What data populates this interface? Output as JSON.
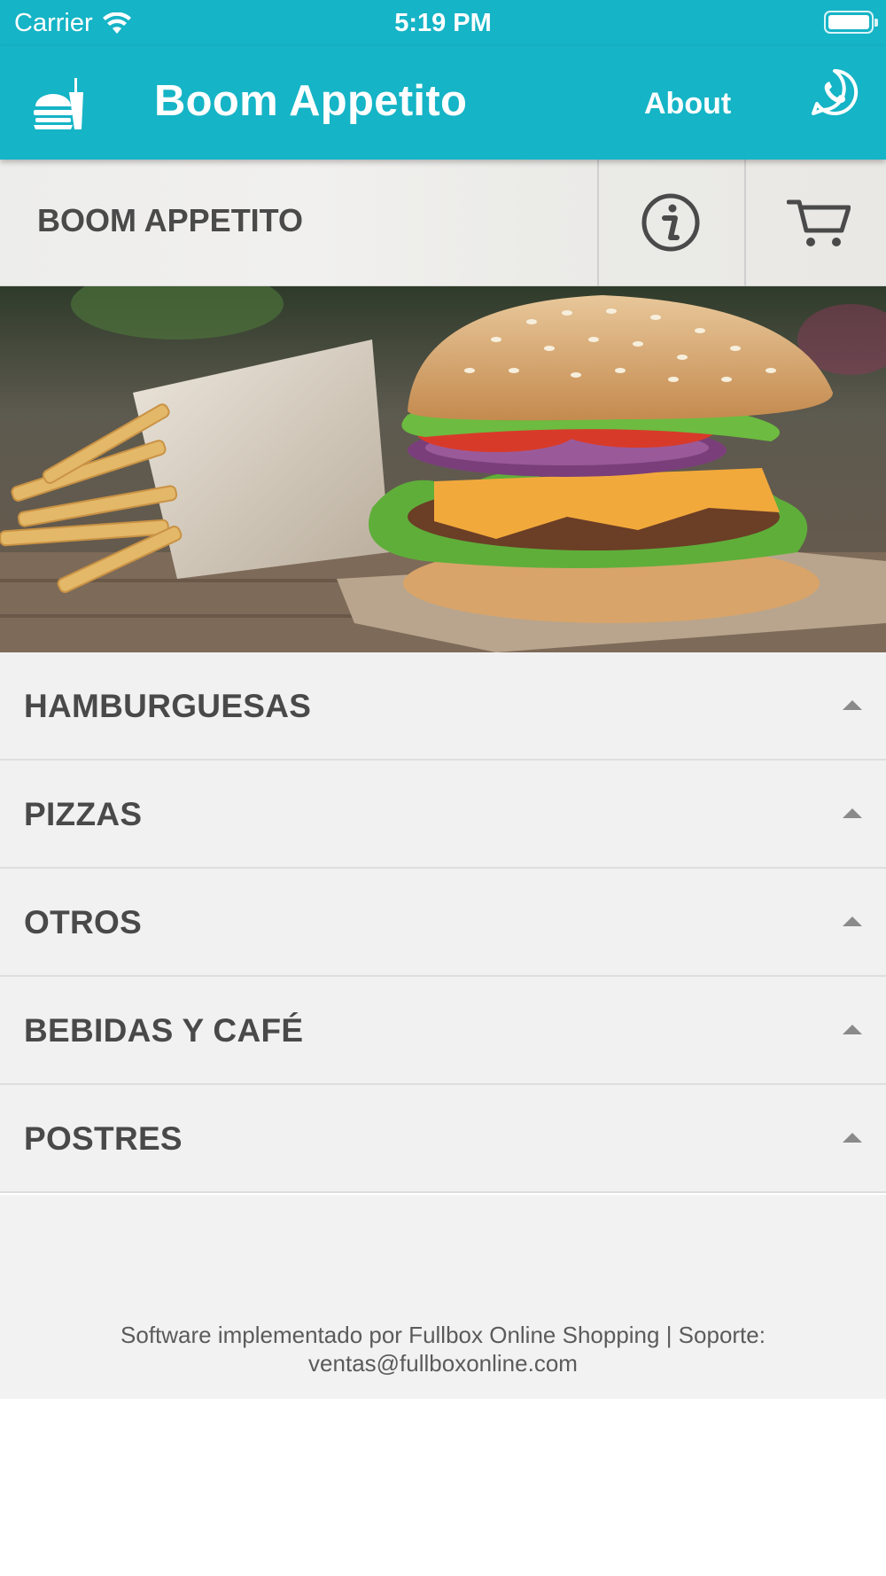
{
  "status_bar": {
    "carrier": "Carrier",
    "time": "5:19 PM",
    "battery_level": 1.0,
    "icons": [
      "wifi-icon",
      "battery-icon"
    ]
  },
  "header": {
    "title": "Boom Appetito",
    "about_label": "About",
    "icons": [
      "restaurant-logo-icon",
      "whatsapp-icon"
    ],
    "background_color": "#15b4c6"
  },
  "store": {
    "name": "BOOM APPETITO",
    "icons": [
      "info-icon",
      "cart-icon"
    ]
  },
  "categories": [
    {
      "label": "HAMBURGUESAS"
    },
    {
      "label": "PIZZAS"
    },
    {
      "label": "OTROS"
    },
    {
      "label": "BEBIDAS Y CAFÉ"
    },
    {
      "label": "POSTRES"
    }
  ],
  "footer": {
    "line1": "Software implementado por Fullbox Online Shopping | Soporte:",
    "line2": "ventas@fullboxonline.com"
  }
}
